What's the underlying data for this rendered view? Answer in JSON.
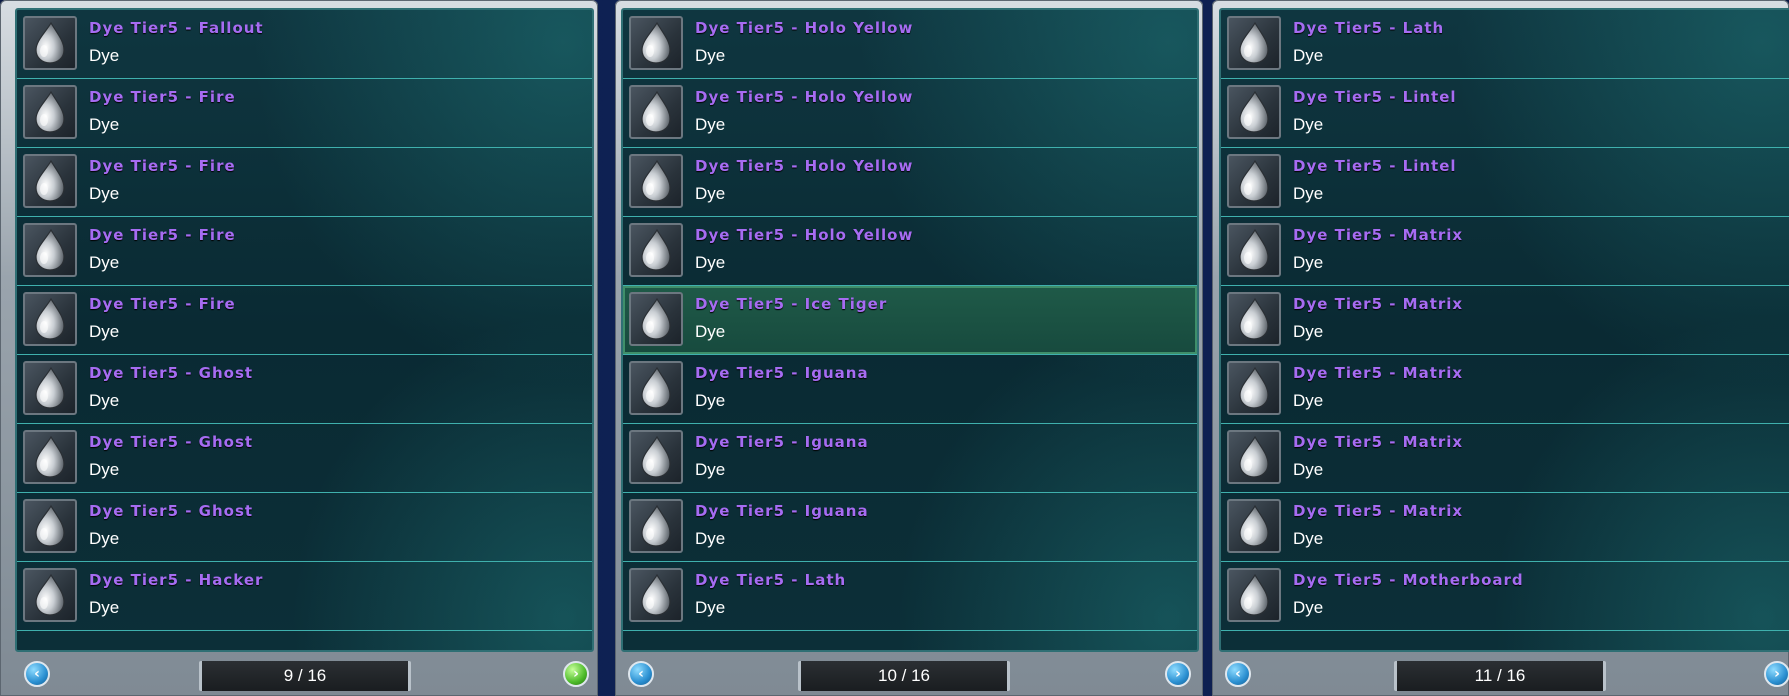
{
  "panels": [
    {
      "page_label": "9 / 16",
      "items": [
        {
          "name": "Dye Tier5 - Fallout",
          "type": "Dye"
        },
        {
          "name": "Dye Tier5 - Fire",
          "type": "Dye"
        },
        {
          "name": "Dye Tier5 - Fire",
          "type": "Dye"
        },
        {
          "name": "Dye Tier5 - Fire",
          "type": "Dye"
        },
        {
          "name": "Dye Tier5 - Fire",
          "type": "Dye"
        },
        {
          "name": "Dye Tier5 - Ghost",
          "type": "Dye"
        },
        {
          "name": "Dye Tier5 - Ghost",
          "type": "Dye"
        },
        {
          "name": "Dye Tier5 - Ghost",
          "type": "Dye"
        },
        {
          "name": "Dye Tier5 - Hacker",
          "type": "Dye"
        }
      ],
      "prev_icon": "chevron-left-icon",
      "next_icon": "chevron-right-icon",
      "next_color": "#4dbb2a"
    },
    {
      "page_label": "10 / 16",
      "items": [
        {
          "name": "Dye Tier5 - Holo Yellow",
          "type": "Dye"
        },
        {
          "name": "Dye Tier5 - Holo Yellow",
          "type": "Dye"
        },
        {
          "name": "Dye Tier5 - Holo Yellow",
          "type": "Dye"
        },
        {
          "name": "Dye Tier5 - Holo Yellow",
          "type": "Dye"
        },
        {
          "name": "Dye Tier5 - Ice Tiger",
          "type": "Dye",
          "selected": true
        },
        {
          "name": "Dye Tier5 - Iguana",
          "type": "Dye"
        },
        {
          "name": "Dye Tier5 - Iguana",
          "type": "Dye"
        },
        {
          "name": "Dye Tier5 - Iguana",
          "type": "Dye"
        },
        {
          "name": "Dye Tier5 - Lath",
          "type": "Dye"
        }
      ],
      "prev_icon": "chevron-left-icon",
      "next_icon": "chevron-right-icon",
      "next_color": "#2a8fd1"
    },
    {
      "page_label": "11 / 16",
      "items": [
        {
          "name": "Dye Tier5 - Lath",
          "type": "Dye"
        },
        {
          "name": "Dye Tier5 - Lintel",
          "type": "Dye"
        },
        {
          "name": "Dye Tier5 - Lintel",
          "type": "Dye"
        },
        {
          "name": "Dye Tier5 - Matrix",
          "type": "Dye"
        },
        {
          "name": "Dye Tier5 - Matrix",
          "type": "Dye"
        },
        {
          "name": "Dye Tier5 - Matrix",
          "type": "Dye"
        },
        {
          "name": "Dye Tier5 - Matrix",
          "type": "Dye"
        },
        {
          "name": "Dye Tier5 - Matrix",
          "type": "Dye"
        },
        {
          "name": "Dye Tier5 - Motherboard",
          "type": "Dye"
        }
      ],
      "prev_icon": "chevron-left-icon",
      "next_icon": "chevron-right-icon",
      "next_color": "#2a8fd1"
    }
  ],
  "colors": {
    "item_name": "#a66cf2",
    "item_type": "#ffffff",
    "row_divider": "#3fb0ad",
    "selected_row": "#1f5a48"
  },
  "item_icon": "dye-drop-icon"
}
